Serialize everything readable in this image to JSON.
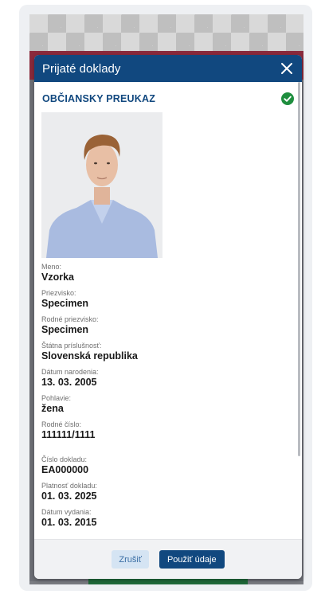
{
  "modal": {
    "title": "Prijaté doklady",
    "close_icon": "close-icon"
  },
  "document": {
    "title": "OBČIANSKY PREUKAZ",
    "status_icon": "check-circle-icon",
    "status_color": "#1e8e3e",
    "fields": [
      {
        "label": "Meno:",
        "value": "Vzorka"
      },
      {
        "label": "Priezvisko:",
        "value": "Specimen"
      },
      {
        "label": "Rodné priezvisko:",
        "value": "Specimen"
      },
      {
        "label": "Štátna príslušnosť:",
        "value": "Slovenská republika"
      },
      {
        "label": "Dátum narodenia:",
        "value": "13. 03. 2005"
      },
      {
        "label": "Pohlavie:",
        "value": "žena"
      },
      {
        "label": "Rodné číslo:",
        "value": "111111/1111"
      },
      {
        "label": "Číslo dokladu:",
        "value": "EA000000"
      },
      {
        "label": "Platnosť dokladu:",
        "value": "01. 03. 2025"
      },
      {
        "label": "Dátum vydania:",
        "value": "01. 03. 2015"
      }
    ]
  },
  "footer": {
    "cancel_label": "Zrušiť",
    "apply_label": "Použiť údaje"
  },
  "colors": {
    "header_bg": "#11487f",
    "accent": "#11487f"
  }
}
